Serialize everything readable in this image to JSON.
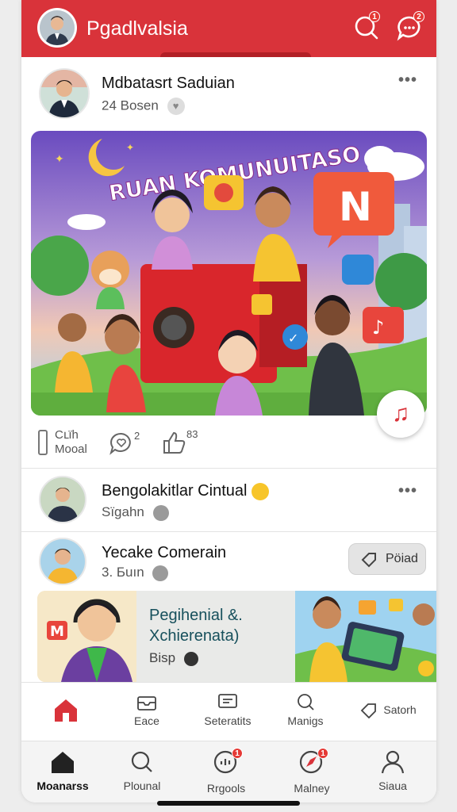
{
  "header": {
    "title": "Pgadlvalsia",
    "notif_badge": "1",
    "chat_badge": "2"
  },
  "post1": {
    "name": "Mdbatasrt Saduian",
    "meta": "24 Bosen",
    "hero_title": "RUAN KOMUNUITASO",
    "hero_letter": "N",
    "actions": {
      "share_line1": "Cւïh",
      "share_line2": "Mooal",
      "comment_count": "2",
      "like_count": "83"
    }
  },
  "post2": {
    "name": "Bengolakitlar Cintual",
    "meta": "Sïgahn"
  },
  "post3": {
    "name": "Yecake Comerain",
    "meta": "3. Бuın",
    "follow_label": "Pöiad"
  },
  "promo": {
    "badge": "M",
    "title_line1": "Pegihenial &.",
    "title_line2": "Xchierenata)",
    "sub": "Bisp"
  },
  "subnav": {
    "items": [
      {
        "label": ""
      },
      {
        "label": "Eace"
      },
      {
        "label": "Seteratits"
      },
      {
        "label": "Manigs"
      },
      {
        "label": "Satorh"
      }
    ]
  },
  "bottomnav": {
    "items": [
      {
        "label": "Moanarss"
      },
      {
        "label": "Plounal"
      },
      {
        "label": "Rrgools",
        "badge": "1"
      },
      {
        "label": "Malney",
        "badge": "1"
      },
      {
        "label": "Siaua"
      }
    ]
  },
  "colors": {
    "brand": "#d9333a",
    "promo_title": "#17505c"
  }
}
